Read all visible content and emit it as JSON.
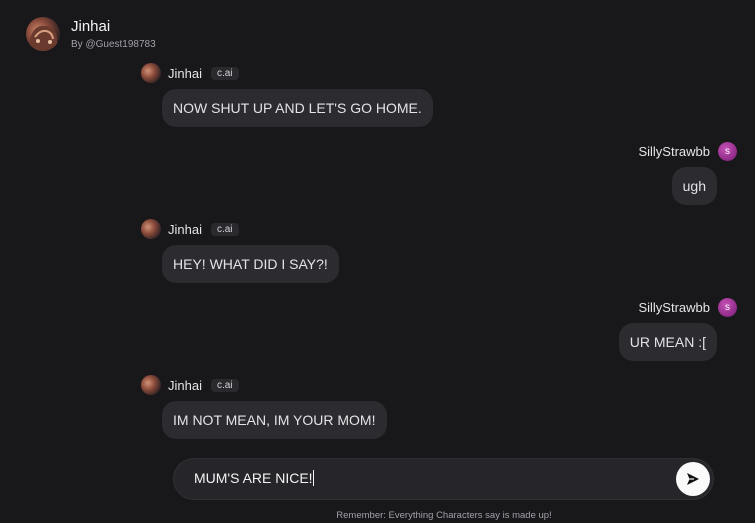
{
  "header": {
    "character_name": "Jinhai",
    "creator": "By @Guest198783"
  },
  "messages": [
    {
      "sender": "Jinhai",
      "badge": "c.ai",
      "text": "NOW SHUT UP AND LET'S GO HOME."
    },
    {
      "sender": "SillyStrawbb",
      "initial": "s",
      "text": "ugh"
    },
    {
      "sender": "Jinhai",
      "badge": "c.ai",
      "text": "HEY! WHAT DID I SAY?!"
    },
    {
      "sender": "SillyStrawbb",
      "initial": "s",
      "text": "UR MEAN :["
    },
    {
      "sender": "Jinhai",
      "badge": "c.ai",
      "text": "IM NOT MEAN, IM YOUR MOM!"
    }
  ],
  "composer": {
    "value": "MUM'S ARE NICE!"
  },
  "footer": {
    "note": "Remember: Everything Characters say is made up!"
  },
  "icons": {
    "send": "send-arrow-icon"
  },
  "colors": {
    "background": "#18181b",
    "bubble": "#2b2b30",
    "user_avatar": "#a33a9a"
  }
}
